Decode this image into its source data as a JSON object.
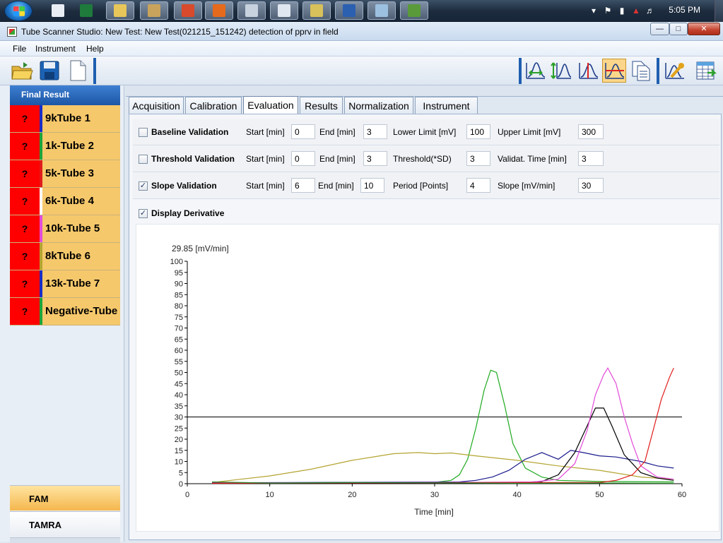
{
  "window": {
    "title": "Tube Scanner Studio: New Test: New Test(021215_151242) detection of pprv in field"
  },
  "taskbar": {
    "clock": "5:05 PM",
    "apps": [
      {
        "name": "notepad-icon",
        "color": "#e9eef5"
      },
      {
        "name": "excel-icon",
        "color": "#1e7b3c"
      },
      {
        "name": "explorer-icon",
        "color": "#e8c65a"
      },
      {
        "name": "paint-icon",
        "color": "#c9a35c"
      },
      {
        "name": "gallery-icon",
        "color": "#d84a2b"
      },
      {
        "name": "firefox-icon",
        "color": "#e66a1b"
      },
      {
        "name": "calculator-icon",
        "color": "#c8d2de"
      },
      {
        "name": "settings-app-icon",
        "color": "#dfe6ef"
      },
      {
        "name": "folder-icon",
        "color": "#d8c05a"
      },
      {
        "name": "word-icon",
        "color": "#2b5fb0"
      },
      {
        "name": "window-app-icon",
        "color": "#9cc0e0"
      },
      {
        "name": "tube-scanner-icon",
        "color": "#5a9a3a"
      }
    ]
  },
  "menu": {
    "file": "File",
    "instrument": "Instrument",
    "help": "Help"
  },
  "left": {
    "header": "Final Result",
    "tubes": [
      {
        "status": "?",
        "name": "9kTube 1",
        "color": "#1a2cc4"
      },
      {
        "status": "?",
        "name": "1k-Tube 2",
        "color": "#1ea43c"
      },
      {
        "status": "?",
        "name": "5k-Tube 3",
        "color": "#e01b1b"
      },
      {
        "status": "?",
        "name": "6k-Tube 4",
        "color": "#ffffff"
      },
      {
        "status": "?",
        "name": "10k-Tube 5",
        "color": "#e34ad9"
      },
      {
        "status": "?",
        "name": "8kTube 6",
        "color": "#b4a431"
      },
      {
        "status": "?",
        "name": "13k-Tube 7",
        "color": "#1a2cc4"
      },
      {
        "status": "?",
        "name": "Negative-Tube",
        "color": "#1ea43c"
      }
    ],
    "channels": {
      "fam": "FAM",
      "tamra": "TAMRA"
    }
  },
  "tabs": [
    "Acquisition",
    "Calibration",
    "Evaluation",
    "Results",
    "Normalization",
    "Instrument"
  ],
  "active_tab": "Evaluation",
  "evaluation": {
    "baseline": {
      "label": "Baseline Validation",
      "checked": false,
      "start_label": "Start [min]",
      "start": "0",
      "end_label": "End [min]",
      "end": "3",
      "lower_label": "Lower Limit [mV]",
      "lower": "100",
      "upper_label": "Upper Limit [mV]",
      "upper": "300"
    },
    "threshold": {
      "label": "Threshold Validation",
      "checked": false,
      "start_label": "Start [min]",
      "start": "0",
      "end_label": "End [min]",
      "end": "3",
      "thr_label": "Threshold(*SD)",
      "thr": "3",
      "time_label": "Validat. Time [min]",
      "time": "3"
    },
    "slope": {
      "label": "Slope Validation",
      "checked": true,
      "start_label": "Start [min]",
      "start": "6",
      "end_label": "End [min]",
      "end": "10",
      "period_label": "Period [Points]",
      "period": "4",
      "slope_label": "Slope [mV/min]",
      "slope": "30"
    },
    "derivative": {
      "label": "Display Derivative",
      "checked": true
    }
  },
  "chart_data": {
    "type": "line",
    "title": "29.85 [mV/min]",
    "xlabel": "Time [min]",
    "ylabel": "",
    "xlim": [
      0,
      60
    ],
    "ylim": [
      0,
      100
    ],
    "xticks": [
      0,
      10,
      20,
      30,
      40,
      50,
      60
    ],
    "yticks": [
      0,
      5,
      10,
      15,
      20,
      25,
      30,
      35,
      40,
      45,
      50,
      55,
      60,
      65,
      70,
      75,
      80,
      85,
      90,
      95,
      100
    ],
    "threshold": 30,
    "threshold_color": "#000000",
    "series": [
      {
        "color": "#22aa22",
        "points": [
          [
            3,
            0.5
          ],
          [
            10,
            0.4
          ],
          [
            20,
            0.5
          ],
          [
            30,
            0.6
          ],
          [
            32,
            1.5
          ],
          [
            33,
            4
          ],
          [
            34,
            11
          ],
          [
            35,
            25
          ],
          [
            36,
            42
          ],
          [
            36.8,
            51
          ],
          [
            37.5,
            50
          ],
          [
            38.5,
            35
          ],
          [
            39.5,
            18
          ],
          [
            41,
            7
          ],
          [
            43,
            3
          ],
          [
            45,
            1.5
          ],
          [
            50,
            1
          ],
          [
            59,
            0.8
          ]
        ]
      },
      {
        "color": "#b4a431",
        "points": [
          [
            3,
            0.5
          ],
          [
            6,
            1.8
          ],
          [
            10,
            3.5
          ],
          [
            15,
            6.5
          ],
          [
            20,
            10.5
          ],
          [
            25,
            13.5
          ],
          [
            28,
            14
          ],
          [
            30,
            13.5
          ],
          [
            32,
            13.8
          ],
          [
            35,
            12.5
          ],
          [
            40,
            10.5
          ],
          [
            45,
            8
          ],
          [
            50,
            6
          ],
          [
            55,
            3
          ],
          [
            59,
            2
          ]
        ]
      },
      {
        "color": "#1a1a8c",
        "points": [
          [
            3,
            0.4
          ],
          [
            20,
            0.6
          ],
          [
            33,
            0.8
          ],
          [
            35,
            1.5
          ],
          [
            37,
            3
          ],
          [
            39,
            6
          ],
          [
            41,
            11
          ],
          [
            43,
            14
          ],
          [
            45,
            11
          ],
          [
            46.5,
            15
          ],
          [
            48,
            14
          ],
          [
            50,
            12.5
          ],
          [
            52,
            12
          ],
          [
            55,
            10
          ],
          [
            57,
            8
          ],
          [
            59,
            7
          ]
        ]
      },
      {
        "color": "#000000",
        "points": [
          [
            3,
            0.2
          ],
          [
            30,
            0.4
          ],
          [
            40,
            0.5
          ],
          [
            43,
            1
          ],
          [
            45,
            4
          ],
          [
            47,
            14
          ],
          [
            48.5,
            26
          ],
          [
            49.5,
            34
          ],
          [
            50.5,
            34
          ],
          [
            51.5,
            26
          ],
          [
            53,
            13
          ],
          [
            55,
            5
          ],
          [
            57,
            2.5
          ],
          [
            59,
            1.5
          ]
        ]
      },
      {
        "color": "#e34ad9",
        "points": [
          [
            3,
            0.3
          ],
          [
            35,
            0.6
          ],
          [
            42,
            0.8
          ],
          [
            45,
            2
          ],
          [
            47,
            9
          ],
          [
            48.5,
            24
          ],
          [
            49.5,
            40
          ],
          [
            50.5,
            49
          ],
          [
            51,
            52
          ],
          [
            52,
            45
          ],
          [
            53,
            30
          ],
          [
            54,
            18
          ],
          [
            55,
            8
          ],
          [
            57,
            3
          ],
          [
            59,
            2
          ]
        ]
      },
      {
        "color": "#e01b1b",
        "points": [
          [
            3,
            0.2
          ],
          [
            40,
            0.5
          ],
          [
            50,
            0.5
          ],
          [
            52,
            1.5
          ],
          [
            54,
            4
          ],
          [
            55.5,
            10
          ],
          [
            56.5,
            24
          ],
          [
            57.5,
            38
          ],
          [
            58.5,
            48
          ],
          [
            59,
            52
          ]
        ]
      },
      {
        "color": "#2a8a2a",
        "points": [
          [
            3,
            0.8
          ],
          [
            10,
            0.3
          ],
          [
            20,
            0.5
          ],
          [
            30,
            0.4
          ],
          [
            40,
            0.2
          ],
          [
            50,
            0.3
          ],
          [
            59,
            0.2
          ]
        ]
      }
    ]
  }
}
